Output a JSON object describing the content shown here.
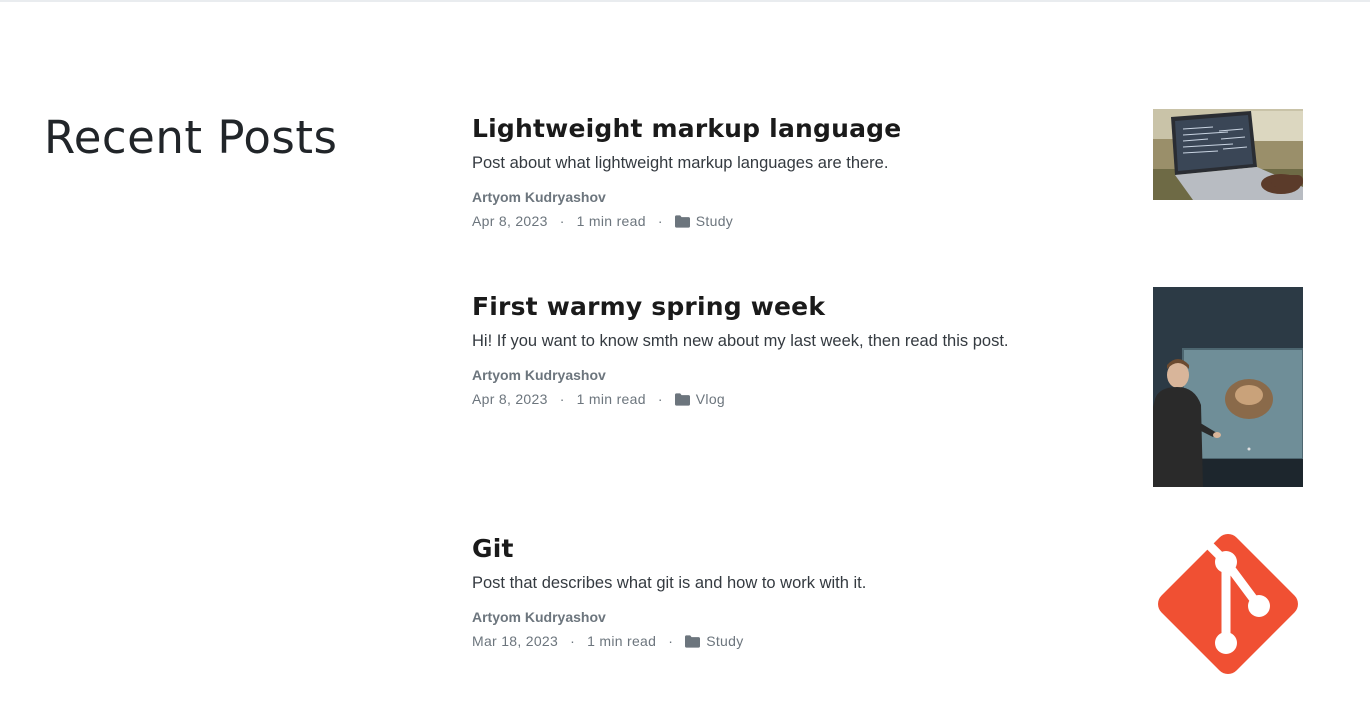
{
  "section": {
    "title": "Recent Posts"
  },
  "posts": [
    {
      "title": "Lightweight markup language",
      "description": "Post about what lightweight markup languages are there.",
      "author": "Artyom Kudryashov",
      "date": "Apr 8, 2023",
      "separator": "·",
      "read_time": "1 min read",
      "category": "Study",
      "thumbnail": "laptop-photo"
    },
    {
      "title": "First warmy spring week",
      "description": "Hi! If you want to know smth new about my last week, then read this post.",
      "author": "Artyom Kudryashov",
      "date": "Apr 8, 2023",
      "separator": "·",
      "read_time": "1 min read",
      "category": "Vlog",
      "thumbnail": "person-with-exhibit-photo"
    },
    {
      "title": "Git",
      "description": "Post that describes what git is and how to work with it.",
      "author": "Artyom Kudryashov",
      "date": "Mar 18, 2023",
      "separator": "·",
      "read_time": "1 min read",
      "category": "Study",
      "thumbnail": "git-logo"
    }
  ],
  "colors": {
    "text": "#212529",
    "muted": "#6c757d",
    "git_orange": "#f05033"
  }
}
